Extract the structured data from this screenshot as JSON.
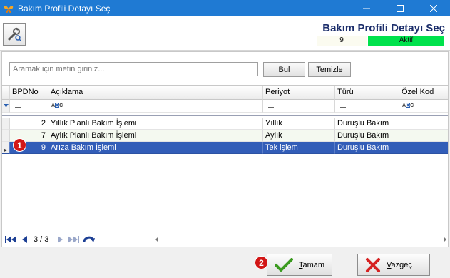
{
  "window": {
    "title": "Bakım Profili Detayı Seç",
    "icon": "butterfly-icon",
    "controls": [
      "minimize-icon",
      "maximize-icon",
      "close-icon"
    ]
  },
  "header": {
    "tool_icon": "wrench-magnifier-icon",
    "title": "Bakım Profili Detayı Seç",
    "number": "9",
    "status": "Aktif",
    "status_color": "#00e24c",
    "title_color": "#1c2e6b"
  },
  "search": {
    "placeholder": "Aramak için metin giriniz...",
    "find_label": "Bul",
    "clear_label": "Temizle"
  },
  "grid": {
    "columns": [
      "BPDNo",
      "Açıklama",
      "Periyot",
      "Türü",
      "Özel Kod"
    ],
    "rows": [
      {
        "no": "2",
        "aciklama": "Yıllık Planlı Bakım İşlemi",
        "periyot": "Yıllık",
        "turu": "Duruşlu Bakım",
        "ozel_kod": ""
      },
      {
        "no": "7",
        "aciklama": "Aylık Planlı Bakım İşlemi",
        "periyot": "Aylık",
        "turu": "Duruşlu Bakım",
        "ozel_kod": ""
      },
      {
        "no": "9",
        "aciklama": "Arıza Bakım İşlemi",
        "periyot": "Tek işlem",
        "turu": "Duruşlu Bakım",
        "ozel_kod": ""
      }
    ],
    "selected_index": 2,
    "selection_color": "#325db8"
  },
  "pager": {
    "page_info": "3 / 3",
    "icons": [
      "first-page-icon",
      "prev-page-icon",
      "next-page-icon",
      "last-page-icon",
      "refresh-icon"
    ]
  },
  "badges": {
    "one": "1",
    "two": "2"
  },
  "buttons": {
    "ok_label_underlined": "T",
    "ok_label_rest": "amam",
    "cancel_label_underlined": "V",
    "cancel_label_rest": "azgeç"
  }
}
